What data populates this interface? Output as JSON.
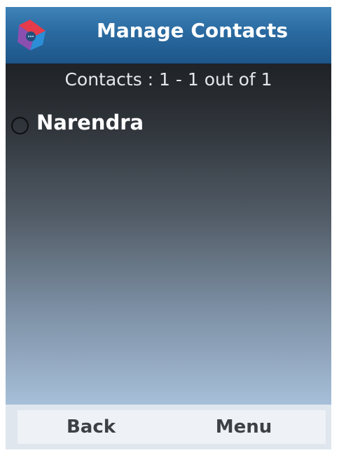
{
  "header": {
    "title": "Manage Contacts",
    "logo_icon": "app-logo-icon"
  },
  "summary": {
    "text": "Contacts : 1 - 1 out of 1"
  },
  "contacts": [
    {
      "name": "Narendra",
      "selected": false,
      "selector_icon": "radio-icon"
    }
  ],
  "softkeys": {
    "left_label": "Back",
    "right_label": "Menu"
  },
  "colors": {
    "header_blue": "#2a6aa0",
    "content_top": "#1f2226",
    "content_bottom": "#a7bfd9",
    "softkey_bar": "#dfe6ee",
    "text_light": "#ffffff",
    "softkey_text": "#3d4145",
    "logo_red": "#e63b4b",
    "logo_purple": "#8b4fb0",
    "logo_blue": "#2c8ed6"
  }
}
